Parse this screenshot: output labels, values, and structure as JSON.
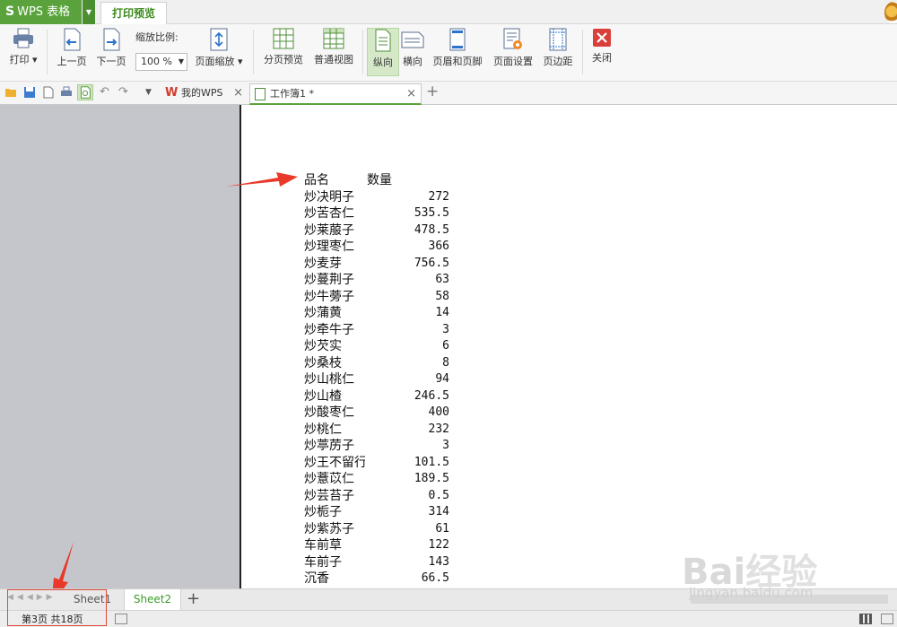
{
  "titlebar": {
    "app_name": "WPS 表格",
    "active_tab": "打印预览"
  },
  "ribbon": {
    "print": "打印",
    "prev_page": "上一页",
    "next_page": "下一页",
    "zoom_label": "缩放比例:",
    "zoom_value": "100 %",
    "page_scale": "页面缩放",
    "page_break_preview": "分页预览",
    "normal_view": "普通视图",
    "portrait": "纵向",
    "landscape": "横向",
    "header_footer": "页眉和页脚",
    "page_setup": "页面设置",
    "margins": "页边距",
    "close": "关闭"
  },
  "doc_tabs": [
    {
      "label": "我的WPS"
    },
    {
      "label": "工作簿1 *"
    }
  ],
  "table": {
    "headers": {
      "name": "品名",
      "qty": "数量"
    },
    "rows": [
      {
        "name": "炒决明子",
        "qty": "272"
      },
      {
        "name": "炒苦杏仁",
        "qty": "535.5"
      },
      {
        "name": "炒莱菔子",
        "qty": "478.5"
      },
      {
        "name": "炒理枣仁",
        "qty": "366"
      },
      {
        "name": "炒麦芽",
        "qty": "756.5"
      },
      {
        "name": "炒蔓荆子",
        "qty": "63"
      },
      {
        "name": "炒牛蒡子",
        "qty": "58"
      },
      {
        "name": "炒蒲黄",
        "qty": "14"
      },
      {
        "name": "炒牵牛子",
        "qty": "3"
      },
      {
        "name": "炒芡实",
        "qty": "6"
      },
      {
        "name": "炒桑枝",
        "qty": "8"
      },
      {
        "name": "炒山桃仁",
        "qty": "94"
      },
      {
        "name": "炒山楂",
        "qty": "246.5"
      },
      {
        "name": "炒酸枣仁",
        "qty": "400"
      },
      {
        "name": "炒桃仁",
        "qty": "232"
      },
      {
        "name": "炒葶苈子",
        "qty": "3"
      },
      {
        "name": "炒王不留行",
        "qty": "101.5"
      },
      {
        "name": "炒薏苡仁",
        "qty": "189.5"
      },
      {
        "name": "炒芸苔子",
        "qty": "0.5"
      },
      {
        "name": "炒栀子",
        "qty": "314"
      },
      {
        "name": "炒紫苏子",
        "qty": "61"
      },
      {
        "name": "车前草",
        "qty": "122"
      },
      {
        "name": "车前子",
        "qty": "143"
      },
      {
        "name": "沉香",
        "qty": "66.5"
      }
    ]
  },
  "sheets": {
    "sheet1": "Sheet1",
    "sheet2": "Sheet2"
  },
  "status": {
    "page_info": "第3页 共18页"
  },
  "watermark": {
    "logo": "Bai经验",
    "url": "jingyan.baidu.com"
  },
  "colors": {
    "brand_green": "#5aa33c",
    "annotation_red": "#e04a3a"
  }
}
